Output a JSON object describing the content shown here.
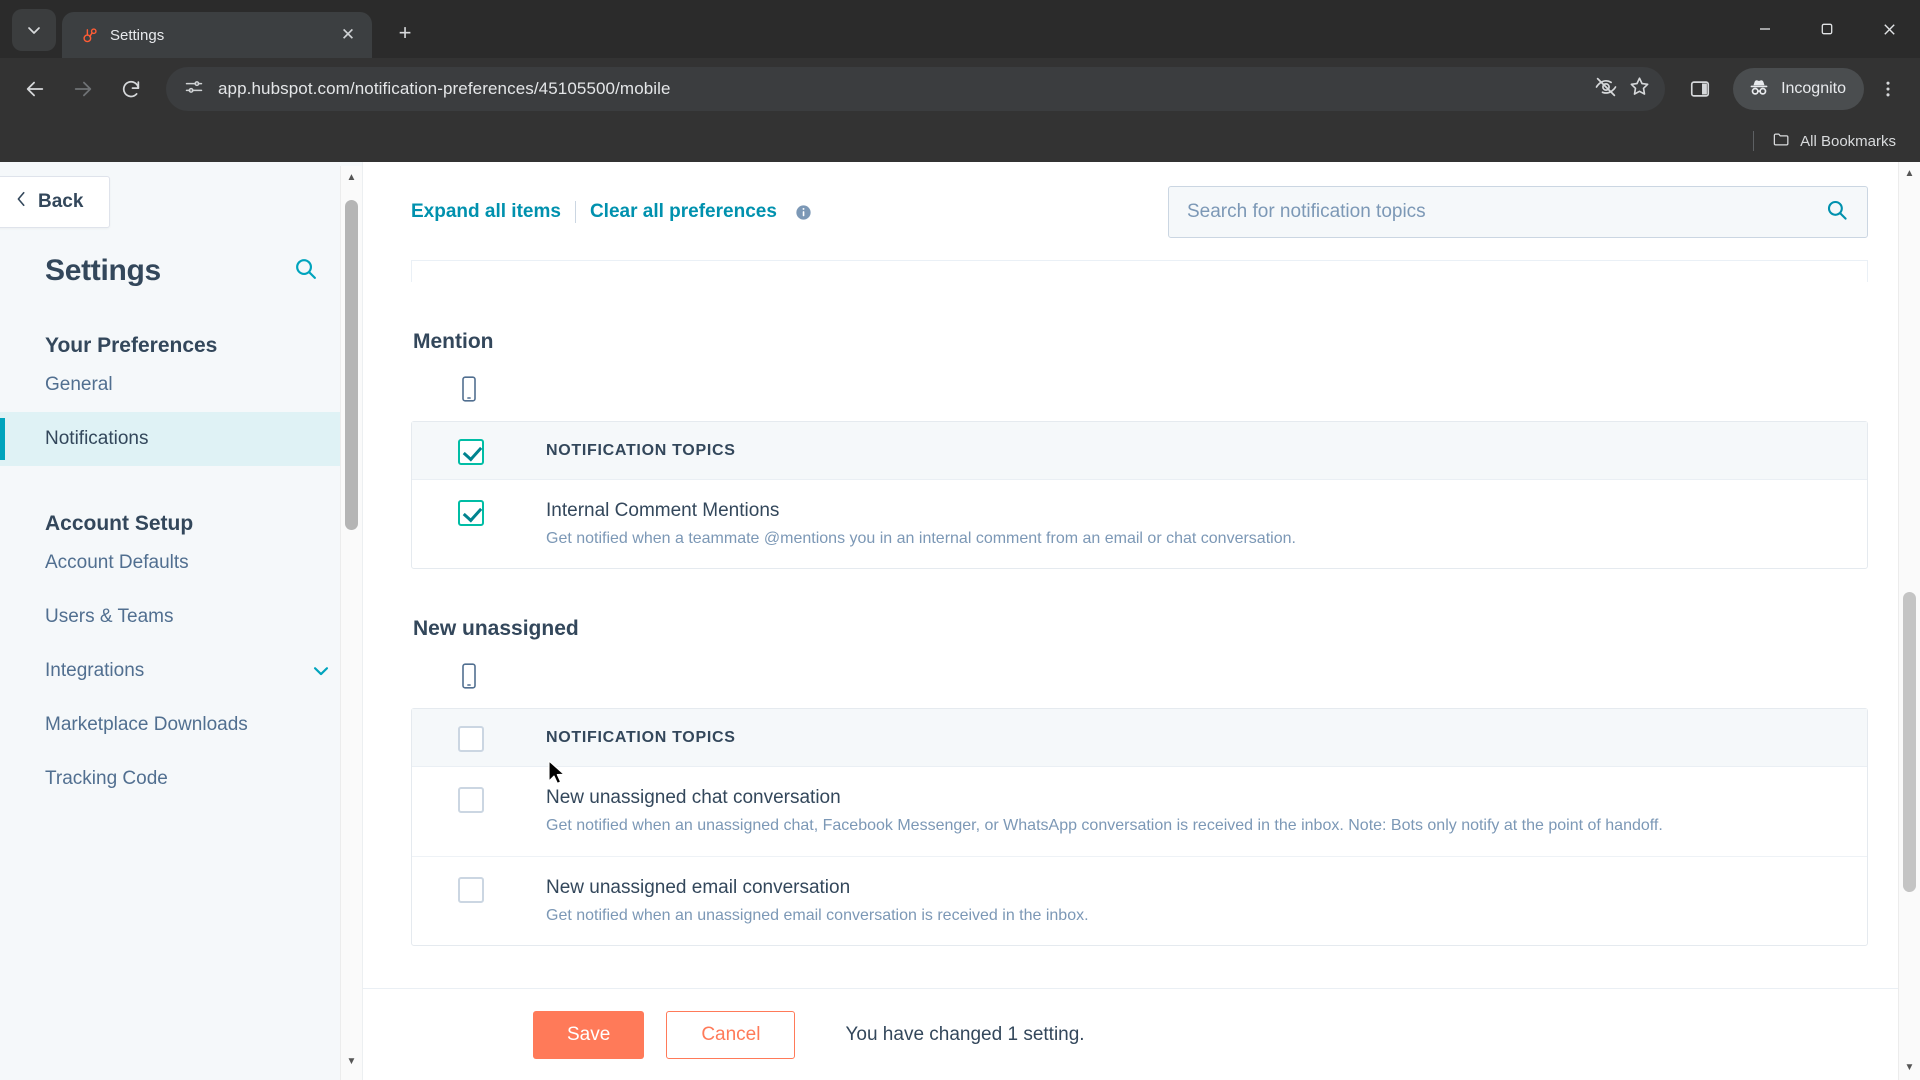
{
  "browser": {
    "tab": {
      "title": "Settings",
      "favicon": "hubspot-sprocket-icon",
      "close_label": "✕"
    },
    "new_tab_label": "+",
    "tab_list_chevron": "⌄",
    "window_controls": {
      "minimize": "—",
      "maximize": "❐",
      "close": "✕"
    },
    "nav": {
      "back": "←",
      "forward": "→",
      "reload": "↻"
    },
    "omnibox": {
      "url": "app.hubspot.com/notification-preferences/45105500/mobile",
      "site_info_icon": "site-settings-icon",
      "tracking_protection_icon": "eye-off-icon",
      "bookmark_icon": "star-icon",
      "side_panel_icon": "side-panel-icon"
    },
    "profile": {
      "label": "Incognito",
      "icon": "incognito-hat-icon"
    },
    "menu_icon": "three-dots-vertical-icon",
    "bookmarks_bar": {
      "all_bookmarks_label": "All Bookmarks",
      "folder_icon": "folder-icon"
    }
  },
  "sidebar": {
    "back_label": "Back",
    "back_icon": "chevron-left-icon",
    "title": "Settings",
    "search_icon": "search-icon",
    "groups": [
      {
        "title": "Your Preferences",
        "items": [
          {
            "label": "General",
            "active": false
          },
          {
            "label": "Notifications",
            "active": true
          }
        ]
      },
      {
        "title": "Account Setup",
        "items": [
          {
            "label": "Account Defaults",
            "active": false
          },
          {
            "label": "Users & Teams",
            "active": false
          },
          {
            "label": "Integrations",
            "active": false,
            "chevron": "chevron-down-icon"
          },
          {
            "label": "Marketplace Downloads",
            "active": false
          },
          {
            "label": "Tracking Code",
            "active": false
          }
        ]
      }
    ],
    "scrollbar": {
      "up_arrow": "▲",
      "down_arrow": "▼"
    }
  },
  "main": {
    "expand_all_label": "Expand all items",
    "clear_all_label": "Clear all preferences",
    "info_icon": "info-circle-icon",
    "search": {
      "placeholder": "Search for notification topics",
      "value": "",
      "icon": "search-icon"
    },
    "sections": [
      {
        "title": "Mention",
        "device_icon": "mobile-phone-icon",
        "header": {
          "label": "NOTIFICATION TOPICS",
          "checked": true
        },
        "rows": [
          {
            "title": "Internal Comment Mentions",
            "desc": "Get notified when a teammate @mentions you in an internal comment from an email or chat conversation.",
            "checked": true
          }
        ]
      },
      {
        "title": "New unassigned",
        "device_icon": "mobile-phone-icon",
        "header": {
          "label": "NOTIFICATION TOPICS",
          "checked": false
        },
        "rows": [
          {
            "title": "New unassigned chat conversation",
            "desc": "Get notified when an unassigned chat, Facebook Messenger, or WhatsApp conversation is received in the inbox. Note: Bots only notify at the point of handoff.",
            "checked": false
          },
          {
            "title": "New unassigned email conversation",
            "desc": "Get notified when an unassigned email conversation is received in the inbox.",
            "checked": false
          }
        ]
      }
    ],
    "scrollbar": {
      "up_arrow": "▲",
      "down_arrow": "▼"
    }
  },
  "action_bar": {
    "save_label": "Save",
    "cancel_label": "Cancel",
    "status_text": "You have changed 1 setting."
  },
  "colors": {
    "accent_teal": "#00a4bd",
    "checkbox_teal": "#00bda5",
    "primary_orange": "#ff7a59",
    "text_dark": "#33475b",
    "text_muted": "#7c98b6",
    "sidebar_bg": "#f5f8fa",
    "active_item_bg": "#dff2f5"
  }
}
